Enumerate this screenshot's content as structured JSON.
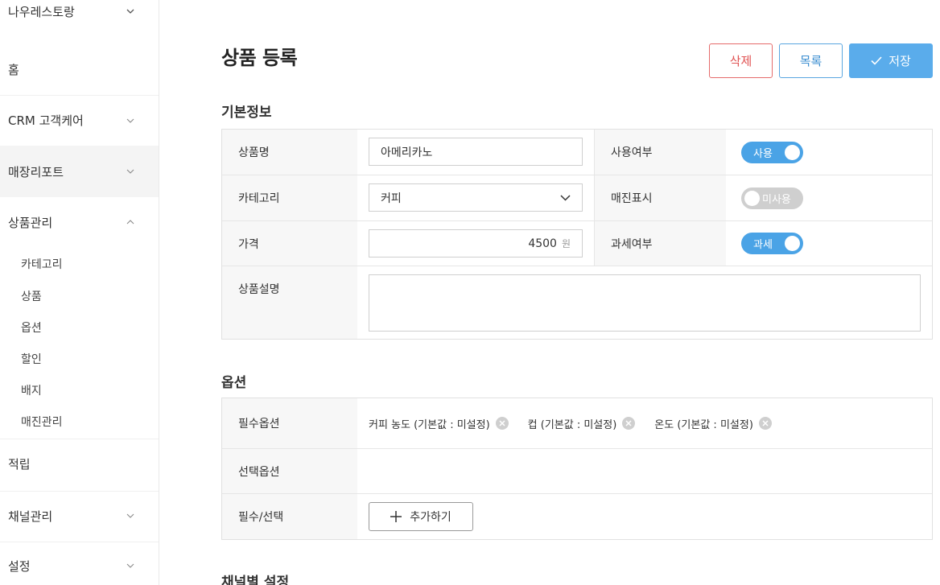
{
  "sidebar": {
    "store_name": "나우레스토랑",
    "home": "홈",
    "crm": "CRM 고객케어",
    "report": "매장리포트",
    "product_mgmt": "상품관리",
    "sub_items": [
      "카테고리",
      "상품",
      "옵션",
      "할인",
      "배지",
      "매진관리"
    ],
    "points": "적립",
    "channel": "채널관리",
    "settings": "설정"
  },
  "page": {
    "title": "상품 등록",
    "delete_label": "삭제",
    "list_label": "목록",
    "save_label": "저장"
  },
  "basic_info": {
    "section_title": "기본정보",
    "name_label": "상품명",
    "name_value": "아메리카노",
    "category_label": "카테고리",
    "category_value": "커피",
    "price_label": "가격",
    "price_value": "4500",
    "price_unit": "원",
    "description_label": "상품설명",
    "use_label": "사용여부",
    "use_toggle": "사용",
    "soldout_label": "매진표시",
    "soldout_toggle": "미사용",
    "tax_label": "과세여부",
    "tax_toggle": "과세"
  },
  "options": {
    "section_title": "옵션",
    "required_label": "필수옵션",
    "required_tags": [
      "커피 농도 (기본값 : 미설정)",
      "컵 (기본값 : 미설정)",
      "온도 (기본값 : 미설정)"
    ],
    "optional_label": "선택옵션",
    "req_sel_label": "필수/선택",
    "add_label": "추가하기"
  },
  "channel_settings": {
    "section_title": "채널별 설정"
  },
  "colors": {
    "accent": "#4aa3e6",
    "danger": "#e05252",
    "toggle_off": "#cfcfcf"
  }
}
